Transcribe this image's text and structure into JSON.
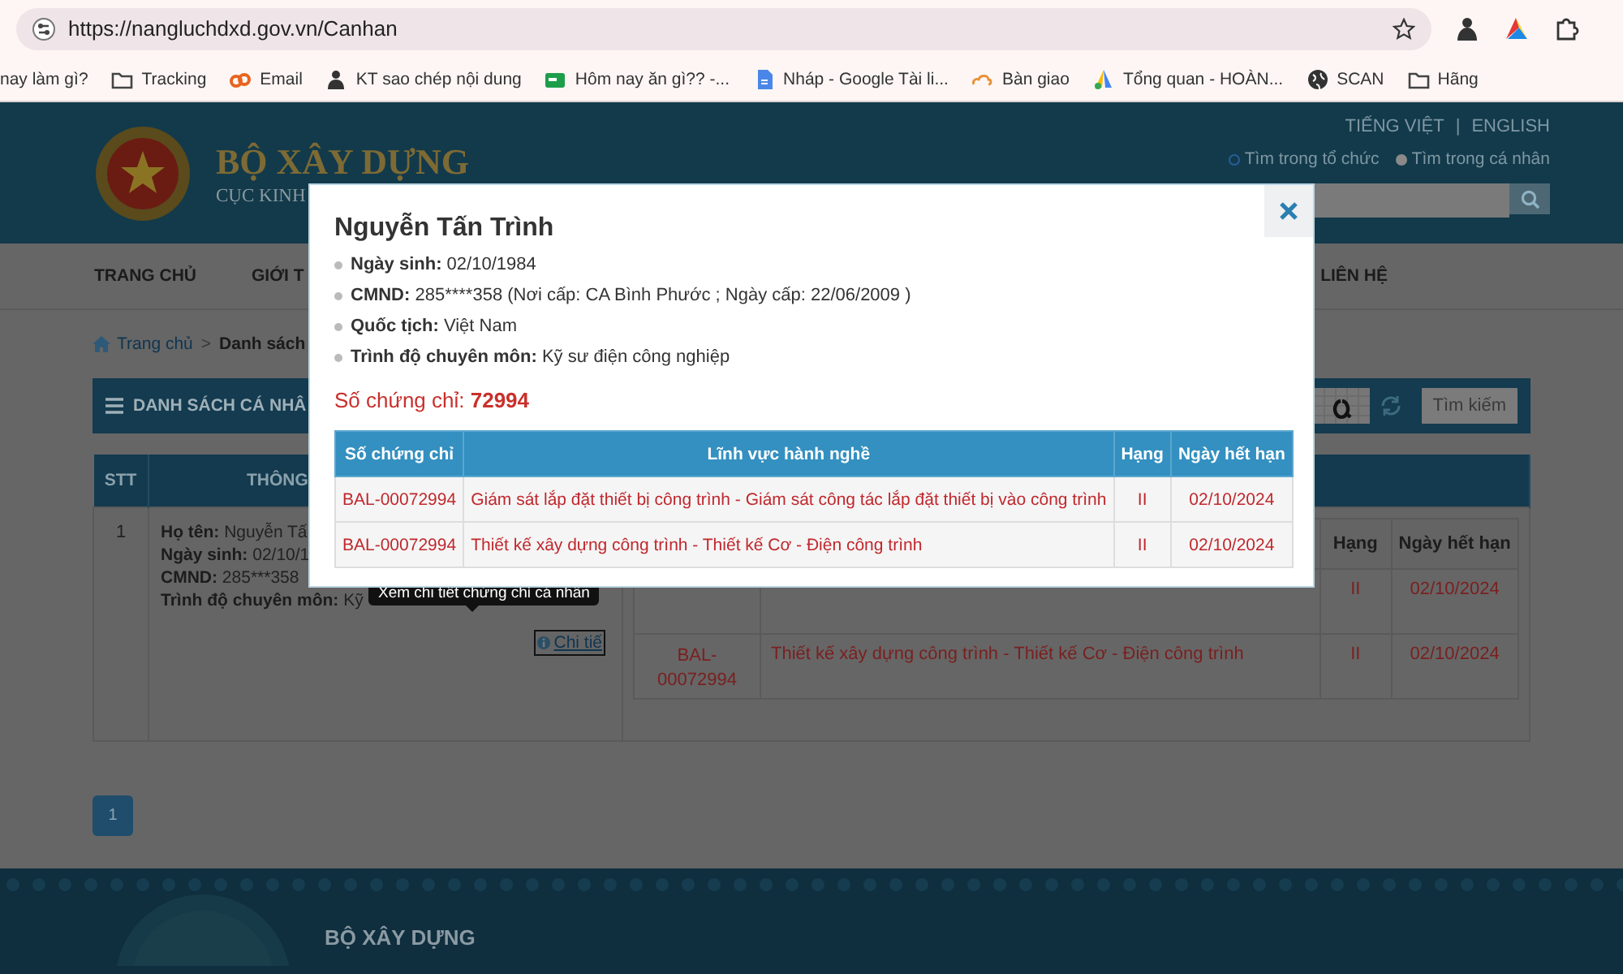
{
  "browser": {
    "url": "https://nangluchdxd.gov.vn/Canhan",
    "bookmarks": [
      "nay làm gì?",
      "Tracking",
      "Email",
      "KT sao chép nội dung",
      "Hôm nay ăn gì?? -...",
      "Nháp - Google Tài li...",
      "Bàn giao",
      "Tổng quan - HOÀN...",
      "SCAN",
      "Hãng"
    ]
  },
  "header": {
    "title": "BỘ XÂY DỰNG",
    "subtitle": "CỤC KINH",
    "languages": [
      "TIẾNG VIỆT",
      "ENGLISH"
    ],
    "language_separator": "|",
    "search_scope": [
      {
        "label": "Tìm trong tổ chức",
        "selected": false
      },
      {
        "label": "Tìm trong cá nhân",
        "selected": true
      }
    ]
  },
  "nav": [
    "TRANG CHỦ",
    "GIỚI T",
    "LIÊN HỆ"
  ],
  "breadcrumb": {
    "items": [
      "Trang chủ",
      "Danh sách"
    ],
    "separator": ">"
  },
  "panel": {
    "title": "DANH SÁCH CÁ NHÂ",
    "search_button": "Tìm kiếm"
  },
  "table": {
    "columns": [
      "STT",
      "THÔNG"
    ],
    "rows": [
      {
        "index": "1",
        "details": [
          {
            "label": "Họ tên:",
            "value": "Nguyễn Tấ"
          },
          {
            "label": "Ngày sinh:",
            "value": "02/10/1"
          },
          {
            "label": "CMND:",
            "value": "285***358"
          },
          {
            "label": "Trình độ chuyên môn:",
            "value": "Kỹ"
          }
        ],
        "detail_link": "Chi tiế",
        "certificates": {
          "columns": [
            "Hạng",
            "Ngày hết hạn"
          ],
          "rows": [
            {
              "rank": "II",
              "expiry": "02/10/2024"
            },
            {
              "number": "BAL-00072994",
              "field": "Thiết kế xây dựng công trình - Thiết kế Cơ - Điện công trình",
              "rank": "II",
              "expiry": "02/10/2024"
            }
          ]
        }
      }
    ]
  },
  "pagination": [
    {
      "label": "1",
      "selected": true
    }
  ],
  "tooltip": "Xem chi tiết chứng chỉ cá nhân",
  "modal": {
    "name": "Nguyễn Tấn Trình",
    "facts": [
      {
        "label": "Ngày sinh:",
        "value": "02/10/1984"
      },
      {
        "label": "CMND:",
        "value": "285****358 (Nơi cấp: CA Bình Phước ; Ngày cấp: 22/06/2009 )"
      },
      {
        "label": "Quốc tịch:",
        "value": "Việt Nam"
      },
      {
        "label": "Trình độ chuyên môn:",
        "value": "Kỹ sư điện công nghiệp"
      }
    ],
    "certificate_label": "Số chứng chỉ:",
    "certificate_number": "72994",
    "table": {
      "columns": [
        "Số chứng chỉ",
        "Lĩnh vực hành nghề",
        "Hạng",
        "Ngày hết hạn"
      ],
      "rows": [
        [
          "BAL-00072994",
          "Giám sát lắp đặt thiết bị công trình - Giám sát công tác lắp đặt thiết bị vào công trình",
          "II",
          "02/10/2024"
        ],
        [
          "BAL-00072994",
          "Thiết kế xây dựng công trình - Thiết kế Cơ - Điện công trình",
          "II",
          "02/10/2024"
        ]
      ]
    }
  },
  "footer": {
    "title": "BỘ XÂY DỰNG"
  }
}
